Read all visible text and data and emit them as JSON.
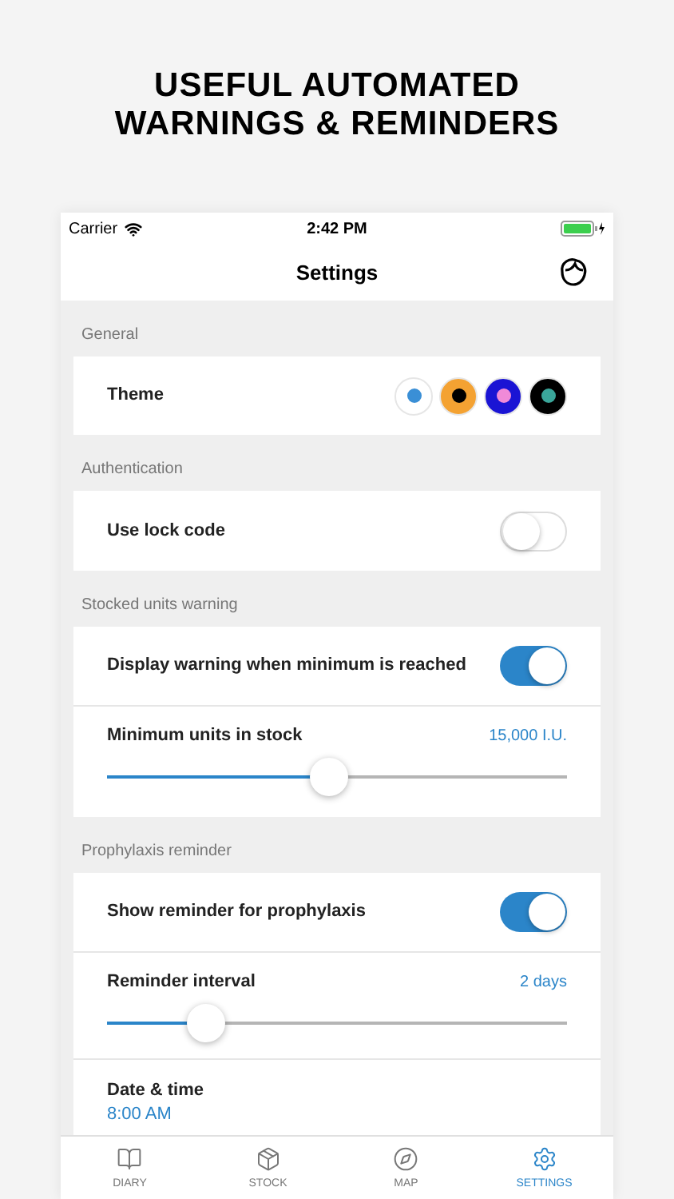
{
  "headline": [
    "USEFUL AUTOMATED",
    "WARNINGS & REMINDERS"
  ],
  "status_bar": {
    "carrier": "Carrier",
    "time": "2:42 PM"
  },
  "nav": {
    "title": "Settings"
  },
  "sections": [
    {
      "title": "General",
      "rows": [
        {
          "kind": "swatches",
          "label": "Theme",
          "swatches": [
            {
              "color": "#ffffff",
              "dot": {
                "color": "#3a8fd6"
              }
            },
            {
              "color": "#f4a232",
              "dot": {
                "color": "#000000"
              }
            },
            {
              "color": "#1a14d4",
              "dot": {
                "color": "#f08ad8"
              }
            },
            {
              "color": "#000000",
              "dot": {
                "color": "#3aa69a"
              }
            }
          ]
        }
      ]
    },
    {
      "title": "Authentication",
      "rows": [
        {
          "kind": "toggle",
          "label": "Use lock code",
          "on": false
        }
      ]
    },
    {
      "title": "Stocked units warning",
      "rows": [
        {
          "kind": "toggle",
          "label": "Display warning when minimum is reached",
          "on": true
        },
        {
          "kind": "slider",
          "label": "Minimum units in stock",
          "value": "15,000 I.U.",
          "level": 0.48
        }
      ]
    },
    {
      "title": "Prophylaxis reminder",
      "rows": [
        {
          "kind": "toggle",
          "label": "Show reminder for prophylaxis",
          "on": true
        },
        {
          "kind": "slider",
          "label": "Reminder interval",
          "value": "2 days",
          "level": 0.19
        },
        {
          "kind": "datetime",
          "label": "Date & time",
          "value": "8:00 AM"
        }
      ]
    }
  ],
  "tabs": [
    {
      "label": "DIARY",
      "selected": false
    },
    {
      "label": "STOCK",
      "selected": false
    },
    {
      "label": "MAP",
      "selected": false
    },
    {
      "label": "SETTINGS",
      "selected": true
    }
  ]
}
